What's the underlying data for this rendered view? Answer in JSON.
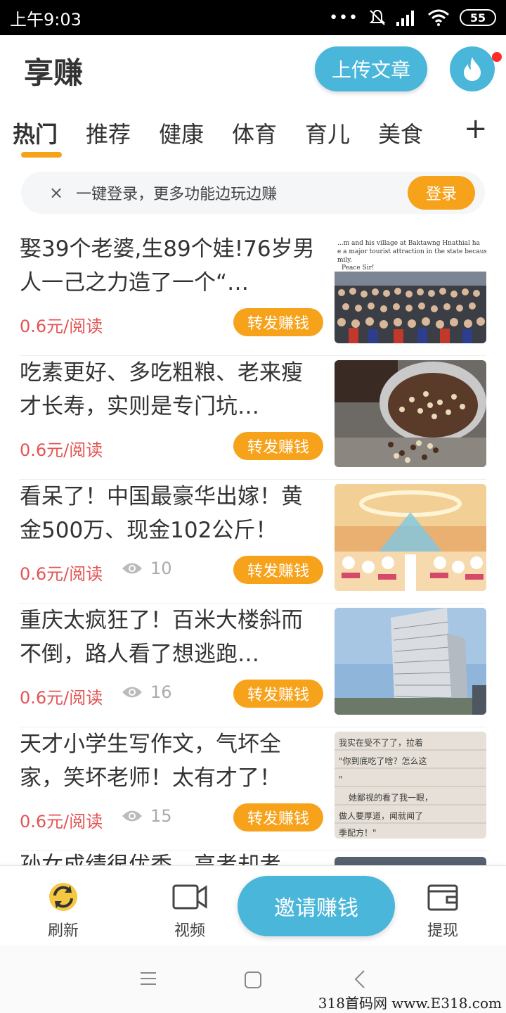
{
  "status_bar": {
    "time": "上午9:03",
    "battery": "55"
  },
  "header": {
    "title": "享赚",
    "upload_label": "上传文章"
  },
  "tabs": [
    {
      "label": "热门"
    },
    {
      "label": "推荐"
    },
    {
      "label": "健康"
    },
    {
      "label": "体育"
    },
    {
      "label": "育儿"
    },
    {
      "label": "美食"
    }
  ],
  "tab_add": "+",
  "login_banner": {
    "close": "×",
    "text": "一键登录，更多功能边玩边赚",
    "button": "登录"
  },
  "articles": [
    {
      "title": "娶39个老婆,生89个娃!76岁男人一己之力造了一个“…",
      "price": "0.6元/阅读",
      "views": "",
      "share": "转发赚钱",
      "thumb_caption": "...m and his village at Baktawng Hnathial...\ne a major tourist attraction in the state becaus\nmily.\nPeace Sir!"
    },
    {
      "title": "吃素更好、多吃粗粮、老来瘦才长寿，实则是专门坑…",
      "price": "0.6元/阅读",
      "views": "",
      "share": "转发赚钱",
      "thumb_caption": ""
    },
    {
      "title": "看呆了！中国最豪华出嫁！黄金500万、现金102公斤！",
      "price": "0.6元/阅读",
      "views": "10",
      "share": "转发赚钱",
      "thumb_caption": ""
    },
    {
      "title": "重庆太疯狂了！百米大楼斜而不倒，路人看了想逃跑…",
      "price": "0.6元/阅读",
      "views": "16",
      "share": "转发赚钱",
      "thumb_caption": ""
    },
    {
      "title": "天才小学生写作文，气坏全家，笑坏老师！太有才了！",
      "price": "0.6元/阅读",
      "views": "15",
      "share": "转发赚钱",
      "thumb_caption": "我实在受不了了，拉着\n\"你到底吃了啥？怎么这\n\"\n她鄙视的看了我一眼，\n做人要厚道，闻就闻了\n季配方！\""
    }
  ],
  "partial_article_title": "孙女成绩很优秀，高考却考",
  "bottom_nav": {
    "refresh": "刷新",
    "video": "视频",
    "invite": "邀请赚钱",
    "withdraw": "提现"
  },
  "watermark": "318首码网 www.E318.com",
  "colors": {
    "accent_blue": "#49b6da",
    "accent_orange": "#f7a21b",
    "price_red": "#e35454"
  }
}
